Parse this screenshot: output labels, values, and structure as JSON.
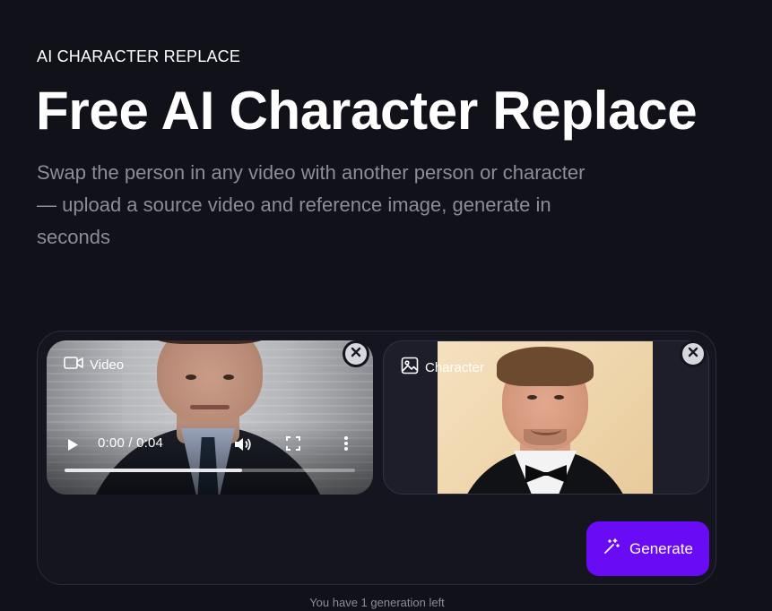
{
  "hero": {
    "eyebrow": "AI CHARACTER REPLACE",
    "title": "Free AI Character Replace",
    "subtitle": "Swap the person in any video with another person or character — upload a source video and reference image, generate in seconds"
  },
  "uploader": {
    "video_slot": {
      "label": "Video",
      "icon": "video-camera-icon",
      "player": {
        "time_display": "0:00 / 0:04",
        "progress_fraction": 0.61
      }
    },
    "character_slot": {
      "label": "Character",
      "icon": "image-icon"
    },
    "generate_label": "Generate",
    "generate_icon": "magic-wand-icon"
  },
  "footer": {
    "generations_left": "You have 1 generation left"
  },
  "colors": {
    "background": "#11111a",
    "panel": "#15151f",
    "accent": "#6a0bf5",
    "muted_text": "#8d8c99"
  }
}
